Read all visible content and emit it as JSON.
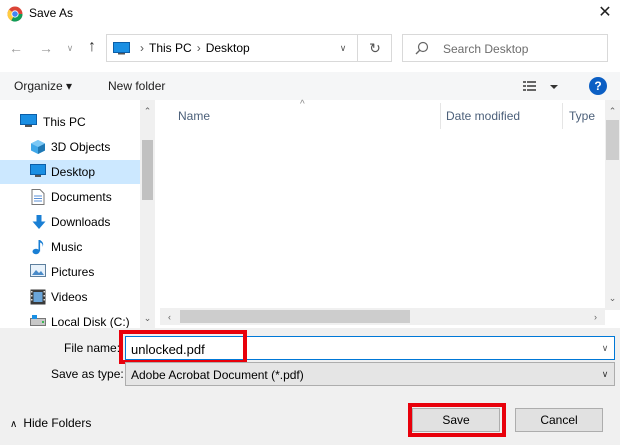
{
  "window": {
    "title": "Save As",
    "close_glyph": "✕"
  },
  "nav": {
    "back_glyph": "←",
    "forward_glyph": "→",
    "recent_glyph": "∨",
    "up_glyph": "↑"
  },
  "address": {
    "crumbs": [
      "This PC",
      "Desktop"
    ],
    "separator": "›",
    "dropdown_glyph": "∨",
    "refresh_glyph": "↻"
  },
  "search": {
    "placeholder": "Search Desktop"
  },
  "toolbar": {
    "organize_label": "Organize ▾",
    "new_folder_label": "New folder",
    "help_glyph": "?"
  },
  "sidebar": {
    "items": [
      {
        "label": "This PC",
        "icon": "computer-icon",
        "selected": false
      },
      {
        "label": "3D Objects",
        "icon": "cube-icon",
        "selected": false
      },
      {
        "label": "Desktop",
        "icon": "desktop-icon",
        "selected": true
      },
      {
        "label": "Documents",
        "icon": "document-icon",
        "selected": false
      },
      {
        "label": "Downloads",
        "icon": "download-icon",
        "selected": false
      },
      {
        "label": "Music",
        "icon": "music-icon",
        "selected": false
      },
      {
        "label": "Pictures",
        "icon": "picture-icon",
        "selected": false
      },
      {
        "label": "Videos",
        "icon": "video-icon",
        "selected": false
      },
      {
        "label": "Local Disk (C:)",
        "icon": "drive-icon",
        "selected": false
      }
    ]
  },
  "filelist": {
    "columns": [
      "Name",
      "Date modified",
      "Type"
    ],
    "sort_glyph": "^"
  },
  "form": {
    "filename_label": "File name:",
    "filename_value": "unlocked.pdf",
    "savetype_label": "Save as type:",
    "savetype_value": "Adobe Acrobat Document (*.pdf)"
  },
  "footer": {
    "hide_folders_label": "Hide Folders",
    "hide_folders_glyph": "∧",
    "save_label": "Save",
    "cancel_label": "Cancel"
  },
  "colors": {
    "selection": "#cce8ff",
    "highlight": "#e8000b",
    "accent": "#0078d7"
  }
}
